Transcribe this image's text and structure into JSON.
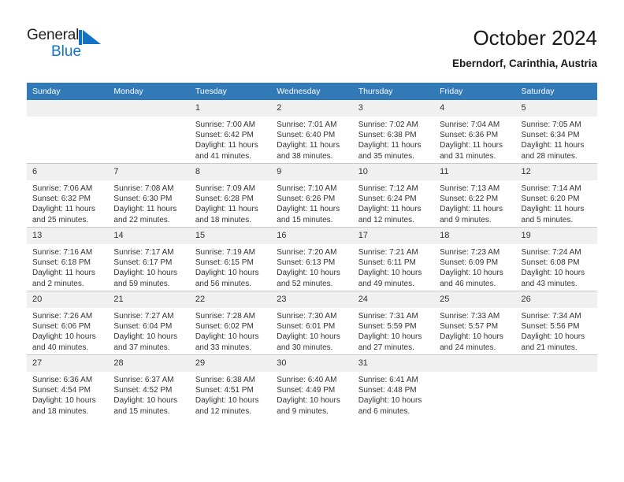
{
  "brand": {
    "name_top": "General",
    "name_bottom": "Blue",
    "mark_icon": "blue-triangle-flag-icon",
    "top_color": "#231f20",
    "bottom_color": "#1273c4"
  },
  "header": {
    "title": "October 2024",
    "subtitle": "Eberndorf, Carinthia, Austria"
  },
  "theme": {
    "header_blue": "#3279b8",
    "daynum_band": "#f0f0f0",
    "grid_line": "#c8c8c8",
    "text": "#333333"
  },
  "calendar": {
    "weekday_headers": [
      "Sunday",
      "Monday",
      "Tuesday",
      "Wednesday",
      "Thursday",
      "Friday",
      "Saturday"
    ],
    "weeks": [
      [
        {
          "day": "",
          "sunrise": "",
          "sunset": "",
          "daylight1": "",
          "daylight2": ""
        },
        {
          "day": "",
          "sunrise": "",
          "sunset": "",
          "daylight1": "",
          "daylight2": ""
        },
        {
          "day": "1",
          "sunrise": "Sunrise: 7:00 AM",
          "sunset": "Sunset: 6:42 PM",
          "daylight1": "Daylight: 11 hours",
          "daylight2": "and 41 minutes."
        },
        {
          "day": "2",
          "sunrise": "Sunrise: 7:01 AM",
          "sunset": "Sunset: 6:40 PM",
          "daylight1": "Daylight: 11 hours",
          "daylight2": "and 38 minutes."
        },
        {
          "day": "3",
          "sunrise": "Sunrise: 7:02 AM",
          "sunset": "Sunset: 6:38 PM",
          "daylight1": "Daylight: 11 hours",
          "daylight2": "and 35 minutes."
        },
        {
          "day": "4",
          "sunrise": "Sunrise: 7:04 AM",
          "sunset": "Sunset: 6:36 PM",
          "daylight1": "Daylight: 11 hours",
          "daylight2": "and 31 minutes."
        },
        {
          "day": "5",
          "sunrise": "Sunrise: 7:05 AM",
          "sunset": "Sunset: 6:34 PM",
          "daylight1": "Daylight: 11 hours",
          "daylight2": "and 28 minutes."
        }
      ],
      [
        {
          "day": "6",
          "sunrise": "Sunrise: 7:06 AM",
          "sunset": "Sunset: 6:32 PM",
          "daylight1": "Daylight: 11 hours",
          "daylight2": "and 25 minutes."
        },
        {
          "day": "7",
          "sunrise": "Sunrise: 7:08 AM",
          "sunset": "Sunset: 6:30 PM",
          "daylight1": "Daylight: 11 hours",
          "daylight2": "and 22 minutes."
        },
        {
          "day": "8",
          "sunrise": "Sunrise: 7:09 AM",
          "sunset": "Sunset: 6:28 PM",
          "daylight1": "Daylight: 11 hours",
          "daylight2": "and 18 minutes."
        },
        {
          "day": "9",
          "sunrise": "Sunrise: 7:10 AM",
          "sunset": "Sunset: 6:26 PM",
          "daylight1": "Daylight: 11 hours",
          "daylight2": "and 15 minutes."
        },
        {
          "day": "10",
          "sunrise": "Sunrise: 7:12 AM",
          "sunset": "Sunset: 6:24 PM",
          "daylight1": "Daylight: 11 hours",
          "daylight2": "and 12 minutes."
        },
        {
          "day": "11",
          "sunrise": "Sunrise: 7:13 AM",
          "sunset": "Sunset: 6:22 PM",
          "daylight1": "Daylight: 11 hours",
          "daylight2": "and 9 minutes."
        },
        {
          "day": "12",
          "sunrise": "Sunrise: 7:14 AM",
          "sunset": "Sunset: 6:20 PM",
          "daylight1": "Daylight: 11 hours",
          "daylight2": "and 5 minutes."
        }
      ],
      [
        {
          "day": "13",
          "sunrise": "Sunrise: 7:16 AM",
          "sunset": "Sunset: 6:18 PM",
          "daylight1": "Daylight: 11 hours",
          "daylight2": "and 2 minutes."
        },
        {
          "day": "14",
          "sunrise": "Sunrise: 7:17 AM",
          "sunset": "Sunset: 6:17 PM",
          "daylight1": "Daylight: 10 hours",
          "daylight2": "and 59 minutes."
        },
        {
          "day": "15",
          "sunrise": "Sunrise: 7:19 AM",
          "sunset": "Sunset: 6:15 PM",
          "daylight1": "Daylight: 10 hours",
          "daylight2": "and 56 minutes."
        },
        {
          "day": "16",
          "sunrise": "Sunrise: 7:20 AM",
          "sunset": "Sunset: 6:13 PM",
          "daylight1": "Daylight: 10 hours",
          "daylight2": "and 52 minutes."
        },
        {
          "day": "17",
          "sunrise": "Sunrise: 7:21 AM",
          "sunset": "Sunset: 6:11 PM",
          "daylight1": "Daylight: 10 hours",
          "daylight2": "and 49 minutes."
        },
        {
          "day": "18",
          "sunrise": "Sunrise: 7:23 AM",
          "sunset": "Sunset: 6:09 PM",
          "daylight1": "Daylight: 10 hours",
          "daylight2": "and 46 minutes."
        },
        {
          "day": "19",
          "sunrise": "Sunrise: 7:24 AM",
          "sunset": "Sunset: 6:08 PM",
          "daylight1": "Daylight: 10 hours",
          "daylight2": "and 43 minutes."
        }
      ],
      [
        {
          "day": "20",
          "sunrise": "Sunrise: 7:26 AM",
          "sunset": "Sunset: 6:06 PM",
          "daylight1": "Daylight: 10 hours",
          "daylight2": "and 40 minutes."
        },
        {
          "day": "21",
          "sunrise": "Sunrise: 7:27 AM",
          "sunset": "Sunset: 6:04 PM",
          "daylight1": "Daylight: 10 hours",
          "daylight2": "and 37 minutes."
        },
        {
          "day": "22",
          "sunrise": "Sunrise: 7:28 AM",
          "sunset": "Sunset: 6:02 PM",
          "daylight1": "Daylight: 10 hours",
          "daylight2": "and 33 minutes."
        },
        {
          "day": "23",
          "sunrise": "Sunrise: 7:30 AM",
          "sunset": "Sunset: 6:01 PM",
          "daylight1": "Daylight: 10 hours",
          "daylight2": "and 30 minutes."
        },
        {
          "day": "24",
          "sunrise": "Sunrise: 7:31 AM",
          "sunset": "Sunset: 5:59 PM",
          "daylight1": "Daylight: 10 hours",
          "daylight2": "and 27 minutes."
        },
        {
          "day": "25",
          "sunrise": "Sunrise: 7:33 AM",
          "sunset": "Sunset: 5:57 PM",
          "daylight1": "Daylight: 10 hours",
          "daylight2": "and 24 minutes."
        },
        {
          "day": "26",
          "sunrise": "Sunrise: 7:34 AM",
          "sunset": "Sunset: 5:56 PM",
          "daylight1": "Daylight: 10 hours",
          "daylight2": "and 21 minutes."
        }
      ],
      [
        {
          "day": "27",
          "sunrise": "Sunrise: 6:36 AM",
          "sunset": "Sunset: 4:54 PM",
          "daylight1": "Daylight: 10 hours",
          "daylight2": "and 18 minutes."
        },
        {
          "day": "28",
          "sunrise": "Sunrise: 6:37 AM",
          "sunset": "Sunset: 4:52 PM",
          "daylight1": "Daylight: 10 hours",
          "daylight2": "and 15 minutes."
        },
        {
          "day": "29",
          "sunrise": "Sunrise: 6:38 AM",
          "sunset": "Sunset: 4:51 PM",
          "daylight1": "Daylight: 10 hours",
          "daylight2": "and 12 minutes."
        },
        {
          "day": "30",
          "sunrise": "Sunrise: 6:40 AM",
          "sunset": "Sunset: 4:49 PM",
          "daylight1": "Daylight: 10 hours",
          "daylight2": "and 9 minutes."
        },
        {
          "day": "31",
          "sunrise": "Sunrise: 6:41 AM",
          "sunset": "Sunset: 4:48 PM",
          "daylight1": "Daylight: 10 hours",
          "daylight2": "and 6 minutes."
        },
        {
          "day": "",
          "sunrise": "",
          "sunset": "",
          "daylight1": "",
          "daylight2": ""
        },
        {
          "day": "",
          "sunrise": "",
          "sunset": "",
          "daylight1": "",
          "daylight2": ""
        }
      ]
    ]
  }
}
